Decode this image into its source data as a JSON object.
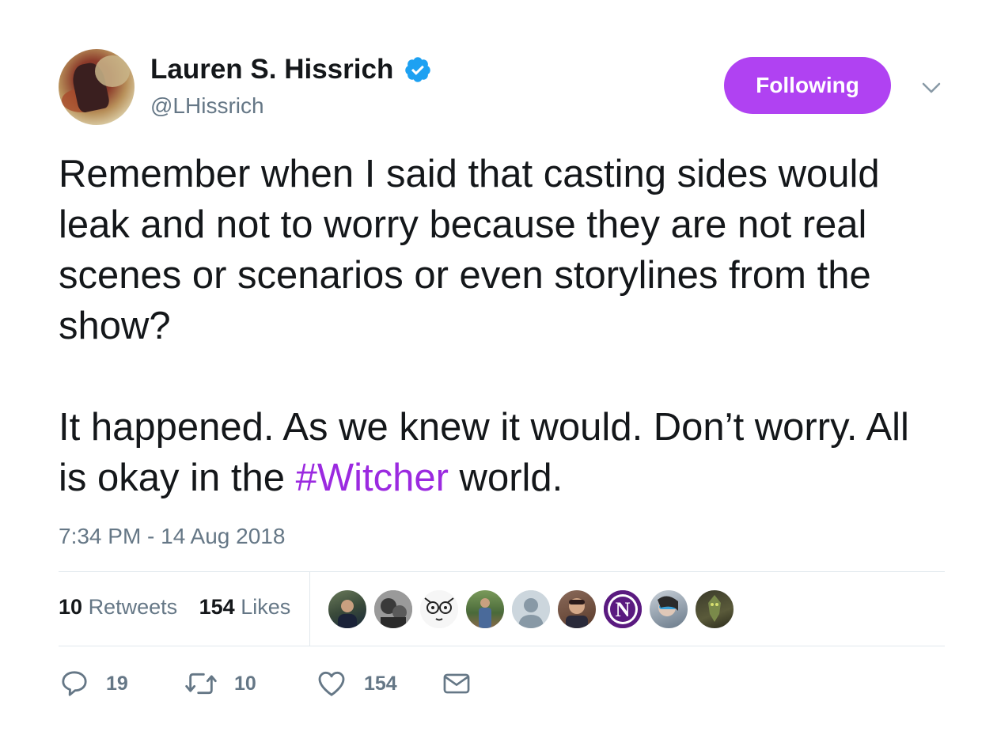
{
  "author": {
    "display_name": "Lauren S. Hissrich",
    "handle": "@LHissrich",
    "verified": true,
    "verified_icon": "verified-badge-icon"
  },
  "follow_button": {
    "label": "Following",
    "color": "#b042f2"
  },
  "tweet": {
    "paragraph1": "Remember when I said that casting sides would leak and not to worry because they are not real scenes or scenarios or even storylines from the show?",
    "paragraph2_before": "It happened. As we knew it would. Don’t worry. All is okay in the ",
    "hashtag": "#Witcher",
    "paragraph2_after": " world.",
    "hashtag_color": "#9b2ae0"
  },
  "timestamp": "7:34 PM - 14 Aug 2018",
  "stats": {
    "retweets_count": "10",
    "retweets_label": "Retweets",
    "likes_count": "154",
    "likes_label": "Likes"
  },
  "liker_avatars": [
    "liker-avatar-1",
    "liker-avatar-2",
    "liker-avatar-3",
    "liker-avatar-4",
    "liker-avatar-5",
    "liker-avatar-6",
    "liker-avatar-7",
    "liker-avatar-8",
    "liker-avatar-9"
  ],
  "liker_avatar_letter": "N",
  "actions": {
    "reply": {
      "icon": "reply-icon",
      "count": "19"
    },
    "retweet": {
      "icon": "retweet-icon",
      "count": "10"
    },
    "like": {
      "icon": "heart-icon",
      "count": "154"
    },
    "dm": {
      "icon": "envelope-icon"
    }
  },
  "colors": {
    "text_primary": "#14171a",
    "text_secondary": "#657786",
    "verified_blue": "#1da1f2",
    "divider": "#e1e8ed"
  }
}
